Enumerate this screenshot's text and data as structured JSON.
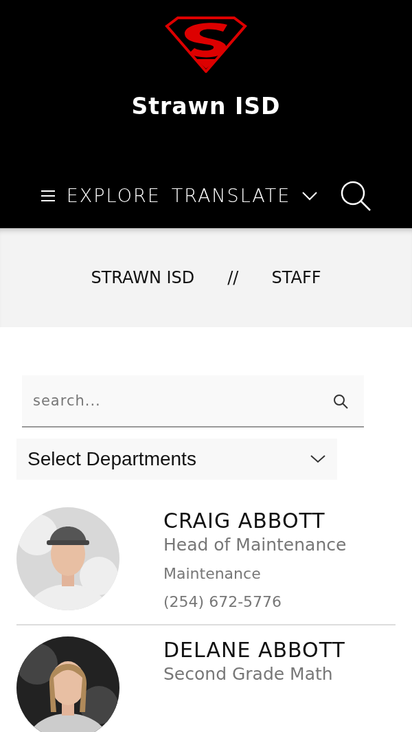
{
  "header": {
    "site_title": "Strawn ISD",
    "nav": [
      {
        "kind": "menu",
        "label": "EXPLORE"
      },
      {
        "kind": "dropdown",
        "label": "TRANSLATE"
      },
      {
        "kind": "search"
      }
    ]
  },
  "breadcrumb": [
    {
      "label": "STRAWN ISD"
    },
    {
      "label": "STAFF"
    }
  ],
  "breadcrumb_separator": "//",
  "search": {
    "placeholder": "search..."
  },
  "department_select": {
    "value": "Select Departments"
  },
  "staff": [
    {
      "name": "CRAIG ABBOTT",
      "title": "Head of Maintenance",
      "department": "Maintenance",
      "phone": "(254) 672-5776"
    },
    {
      "name": "DELANE ABBOTT",
      "title": "Second Grade Math"
    }
  ]
}
